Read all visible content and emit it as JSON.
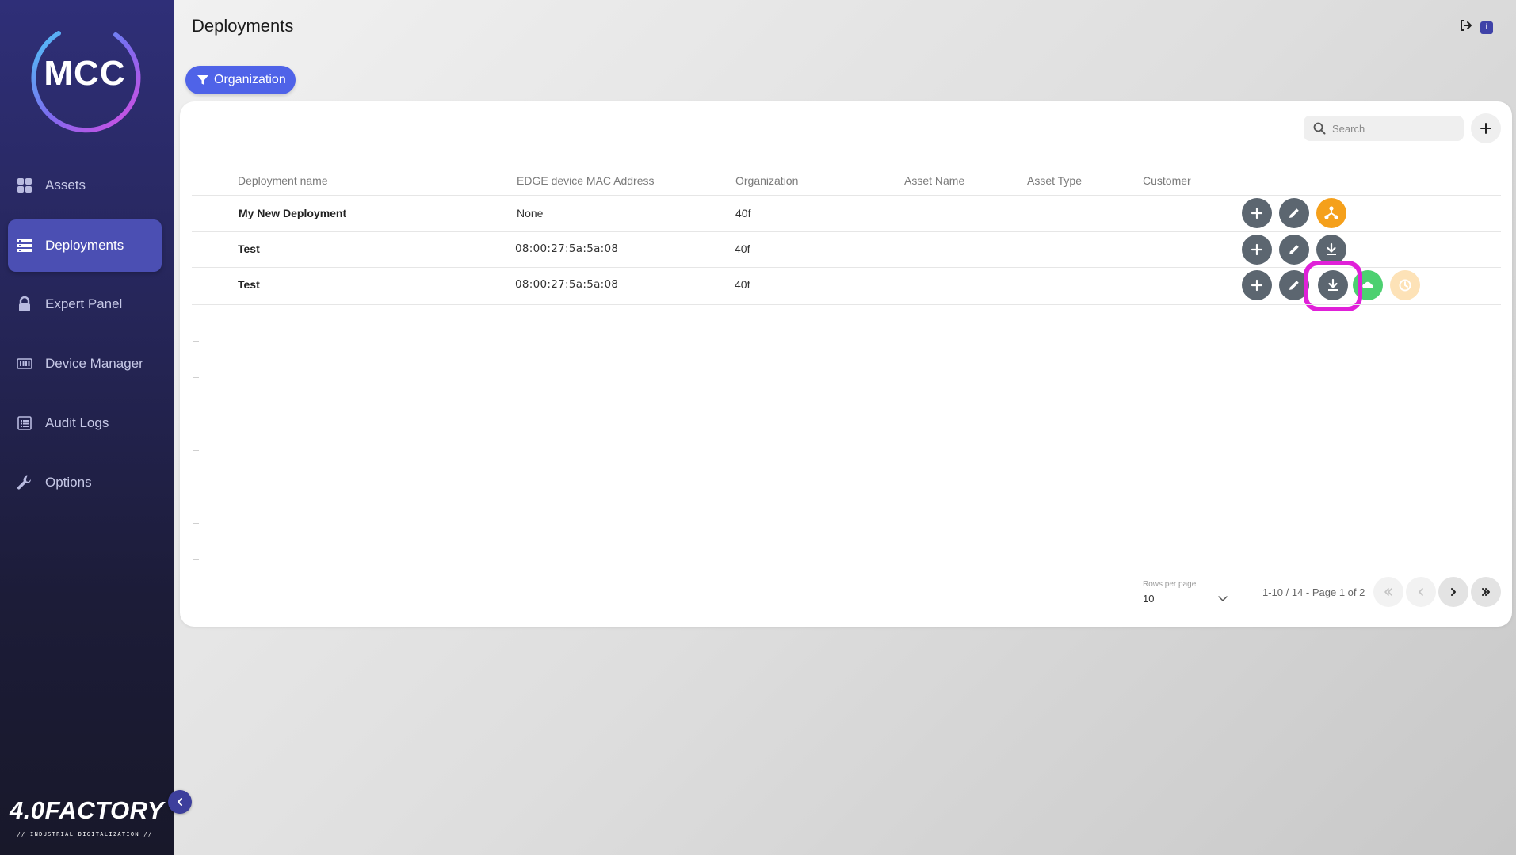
{
  "app": {
    "logo_text": "MCC",
    "brand": "4.0FACTORY",
    "brand_tagline": "// INDUSTRIAL DIGITALIZATION //"
  },
  "sidebar": {
    "items": [
      {
        "label": "Assets",
        "icon": "grid-icon"
      },
      {
        "label": "Deployments",
        "icon": "server-list-icon",
        "active": true
      },
      {
        "label": "Expert Panel",
        "icon": "lock-icon"
      },
      {
        "label": "Device Manager",
        "icon": "keyboard-icon"
      },
      {
        "label": "Audit Logs",
        "icon": "list-icon"
      },
      {
        "label": "Options",
        "icon": "wrench-icon"
      }
    ]
  },
  "header": {
    "title": "Deployments",
    "filter_chip": "Organization",
    "info_badge": "i"
  },
  "toolbar": {
    "search_placeholder": "Search"
  },
  "table": {
    "columns": [
      "Deployment name",
      "EDGE device MAC Address",
      "Organization",
      "Asset Name",
      "Asset Type",
      "Customer"
    ],
    "rows": [
      {
        "name": "My New Deployment",
        "mac": "None",
        "organization": "40f",
        "asset_name": "",
        "asset_type": "",
        "customer": ""
      },
      {
        "name": "Test",
        "mac": "08:00:27:5a:5a:08",
        "organization": "40f",
        "asset_name": "",
        "asset_type": "",
        "customer": ""
      },
      {
        "name": "Test",
        "mac": "08:00:27:5a:5a:08",
        "organization": "40f",
        "asset_name": "",
        "asset_type": "",
        "customer": ""
      }
    ]
  },
  "pagination": {
    "rows_per_page_label": "Rows per page",
    "rows_per_page": "10",
    "info": "1-10 / 14 - Page 1 of 2"
  },
  "colors": {
    "accent": "#4f63e8",
    "sidebar_active": "#4b4fb3",
    "action_gray": "#5c6670",
    "action_orange": "#f5a01b",
    "action_green": "#4cd070",
    "highlight": "#e020d8"
  }
}
